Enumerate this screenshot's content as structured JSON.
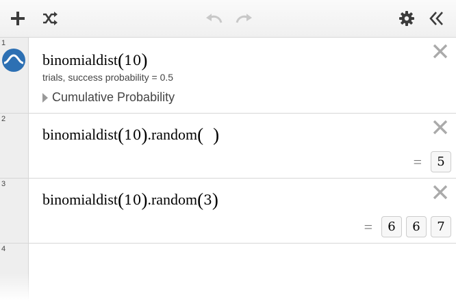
{
  "toolbar": {
    "add_icon": "plus-icon",
    "shuffle_icon": "shuffle-icon",
    "undo_icon": "undo-icon",
    "redo_icon": "redo-icon",
    "settings_icon": "gear-icon",
    "collapse_icon": "double-chevron-left-icon"
  },
  "expressions": [
    {
      "number": "1",
      "func": "binomialdist",
      "arg": "10",
      "subtitle": "trials, success probability = 0.5",
      "folder_label": "Cumulative Probability",
      "icon": "distribution-icon"
    },
    {
      "number": "2",
      "func": "binomialdist",
      "arg": "10",
      "method": ".random",
      "method_arg": "",
      "result_eq": "=",
      "results": [
        "5"
      ]
    },
    {
      "number": "3",
      "func": "binomialdist",
      "arg": "10",
      "method": ".random",
      "method_arg": "3",
      "result_eq": "=",
      "results": [
        "6",
        "6",
        "7"
      ]
    },
    {
      "number": "4"
    }
  ],
  "colors": {
    "accent": "#2d70b3",
    "toolbar_bg": "#f0f0f0",
    "gutter_bg": "#eeeeee",
    "icon_gray": "#444444",
    "disabled_gray": "#c8c8c8"
  }
}
